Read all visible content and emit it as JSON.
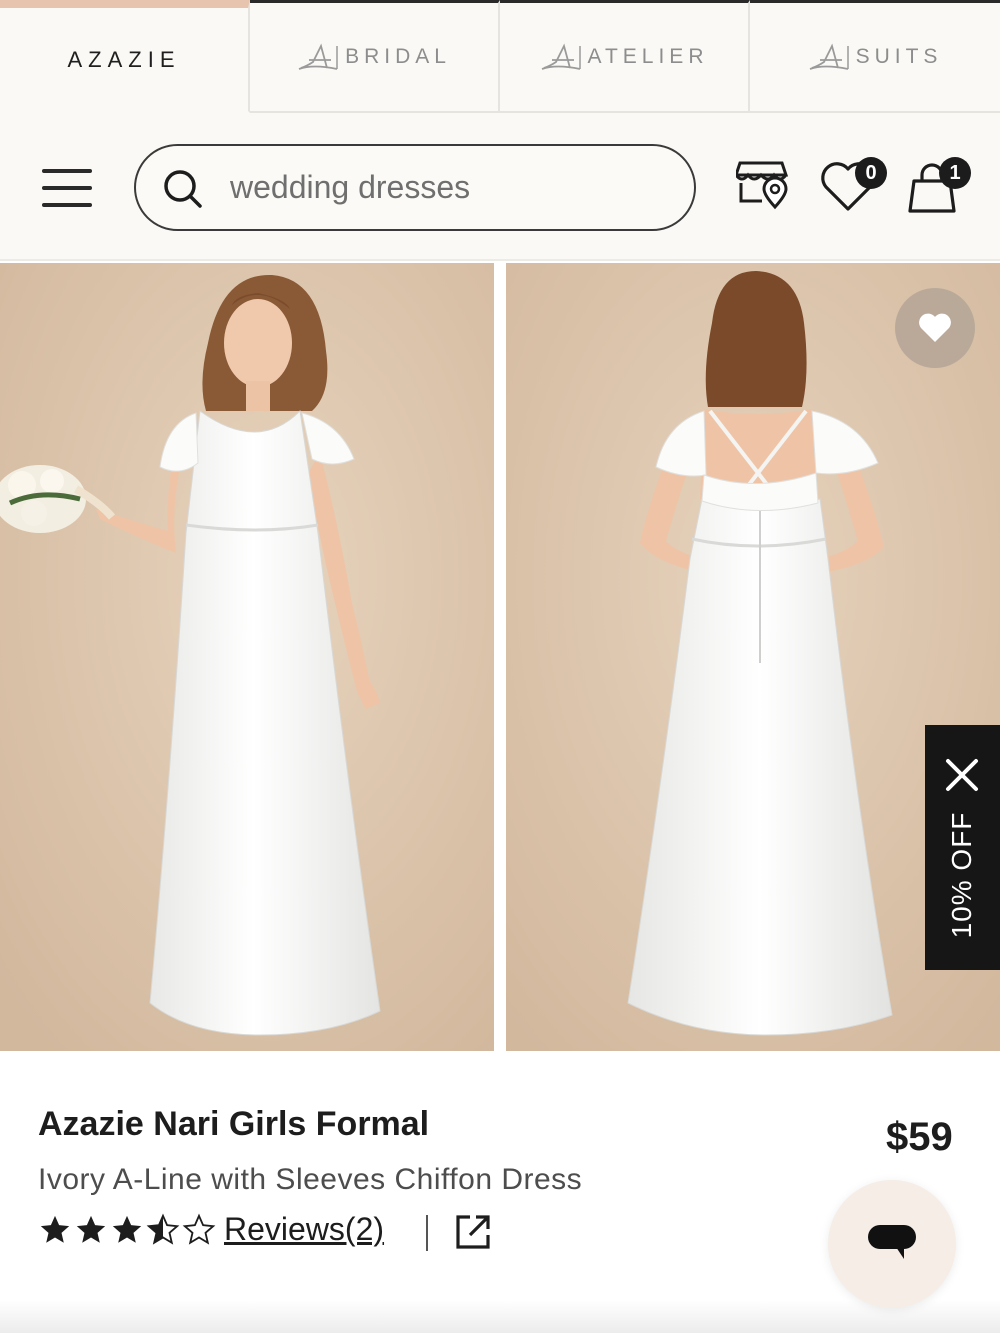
{
  "brand_tabs": [
    {
      "label": "AZAZIE",
      "active": true
    },
    {
      "label": "BRIDAL",
      "active": false
    },
    {
      "label": "ATELIER",
      "active": false
    },
    {
      "label": "SUITS",
      "active": false
    }
  ],
  "search": {
    "value": "wedding dresses"
  },
  "header": {
    "wishlist_count": "0",
    "cart_count": "1"
  },
  "promo": {
    "label": "10% OFF"
  },
  "product": {
    "title": "Azazie Nari Girls Formal",
    "subtitle": "Ivory A-Line with Sleeves Chiffon Dress",
    "price": "$59",
    "rating": 3.5,
    "reviews_label": "Reviews(2)"
  },
  "colors": {
    "accent": "#e7c4ad",
    "dark": "#161616",
    "backdrop": "#d8c1a7"
  },
  "icons": [
    "menu-icon",
    "search-icon",
    "store-locator-icon",
    "heart-icon",
    "cart-icon",
    "close-icon",
    "share-icon",
    "chat-icon"
  ]
}
